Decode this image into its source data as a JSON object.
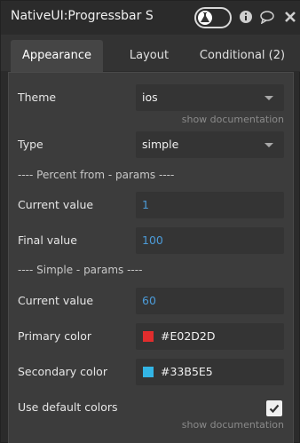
{
  "header": {
    "title": "NativeUI:Progressbar Sir",
    "toggle_icon": "flask-icon",
    "info_icon": "info-icon",
    "comment_icon": "comment-icon",
    "close_icon": "close-icon"
  },
  "tabs": [
    {
      "label": "Appearance",
      "active": true
    },
    {
      "label": "Layout",
      "active": false
    },
    {
      "label": "Conditional (2)",
      "active": false
    }
  ],
  "form": {
    "theme": {
      "label": "Theme",
      "value": "ios",
      "doc": "show documentation"
    },
    "type": {
      "label": "Type",
      "value": "simple"
    },
    "section_percent": "---- Percent from - params ----",
    "current_value_percent": {
      "label": "Current value",
      "value": "1"
    },
    "final_value": {
      "label": "Final value",
      "value": "100"
    },
    "section_simple": "---- Simple - params ----",
    "current_value_simple": {
      "label": "Current value",
      "value": "60"
    },
    "primary_color": {
      "label": "Primary color",
      "value": "#E02D2D",
      "swatch": "#E02D2D"
    },
    "secondary_color": {
      "label": "Secondary color",
      "value": "#33B5E5",
      "swatch": "#33B5E5"
    },
    "use_default_colors": {
      "label": "Use default colors",
      "checked": true,
      "doc": "show documentation"
    }
  }
}
